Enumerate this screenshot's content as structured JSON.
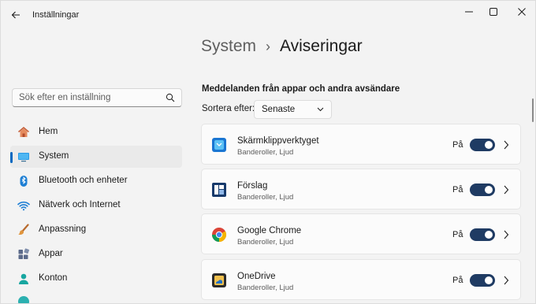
{
  "window": {
    "title": "Inställningar"
  },
  "sidebar": {
    "search_placeholder": "Sök efter en inställning",
    "items": [
      {
        "label": "Hem"
      },
      {
        "label": "System"
      },
      {
        "label": "Bluetooth och enheter"
      },
      {
        "label": "Nätverk och Internet"
      },
      {
        "label": "Anpassning"
      },
      {
        "label": "Appar"
      },
      {
        "label": "Konton"
      }
    ]
  },
  "breadcrumb": {
    "parent": "System",
    "separator": "›",
    "current": "Aviseringar"
  },
  "main": {
    "section_heading": "Meddelanden från appar och andra avsändare",
    "sort_label": "Sortera efter:",
    "sort_value": "Senaste",
    "apps": [
      {
        "name": "Skärmklippverktyget",
        "subtitle": "Banderoller, Ljud",
        "state": "På",
        "on": true
      },
      {
        "name": "Förslag",
        "subtitle": "Banderoller, Ljud",
        "state": "På",
        "on": true
      },
      {
        "name": "Google Chrome",
        "subtitle": "Banderoller, Ljud",
        "state": "På",
        "on": true
      },
      {
        "name": "OneDrive",
        "subtitle": "Banderoller, Ljud",
        "state": "På",
        "on": true
      }
    ]
  },
  "colors": {
    "accent": "#0067c0",
    "toggle_on": "#1f3b63"
  }
}
